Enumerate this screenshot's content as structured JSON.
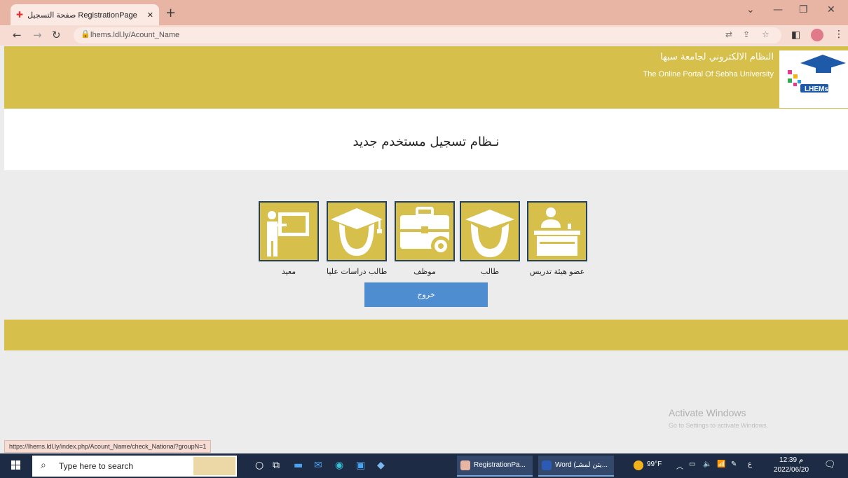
{
  "browser": {
    "tab_title": "صفحة التسجيل RegistrationPage",
    "new_tab": "+",
    "url": "lhems.ldl.ly/Acount_Name",
    "status_url": "https://lhems.ldl.ly/index.php/Acount_Name/check_National?groupN=1"
  },
  "header": {
    "title_ar": "النظام الالكتروني لجامعة سبها",
    "title_en": "The Online Portal Of Sebha University",
    "logo_text": "LHEMs"
  },
  "page": {
    "title": "نـظام تسجيل مستخدم جديد"
  },
  "options": [
    {
      "label": "معيد",
      "icon": "teacher-board-icon"
    },
    {
      "label": "طالب دراسات عليا",
      "icon": "graduate-icon"
    },
    {
      "label": "موظف",
      "icon": "employee-briefcase-icon"
    },
    {
      "label": "طالب",
      "icon": "student-icon"
    },
    {
      "label": "عضو هيئة تدريس",
      "icon": "faculty-desk-icon"
    }
  ],
  "exit_button": "خروج",
  "watermark": {
    "line1": "Activate Windows",
    "line2": "Go to Settings to activate Windows."
  },
  "taskbar": {
    "search_placeholder": "Type here to search",
    "app1": "RegistrationPa...",
    "app2": "Word (يتن لمشـ...",
    "temperature": "99°F",
    "time": "12:39 م",
    "date": "2022/06/20"
  },
  "colors": {
    "gold": "#d6bf4a",
    "button_blue": "#4e8ed0",
    "icon_border": "#26415f"
  }
}
